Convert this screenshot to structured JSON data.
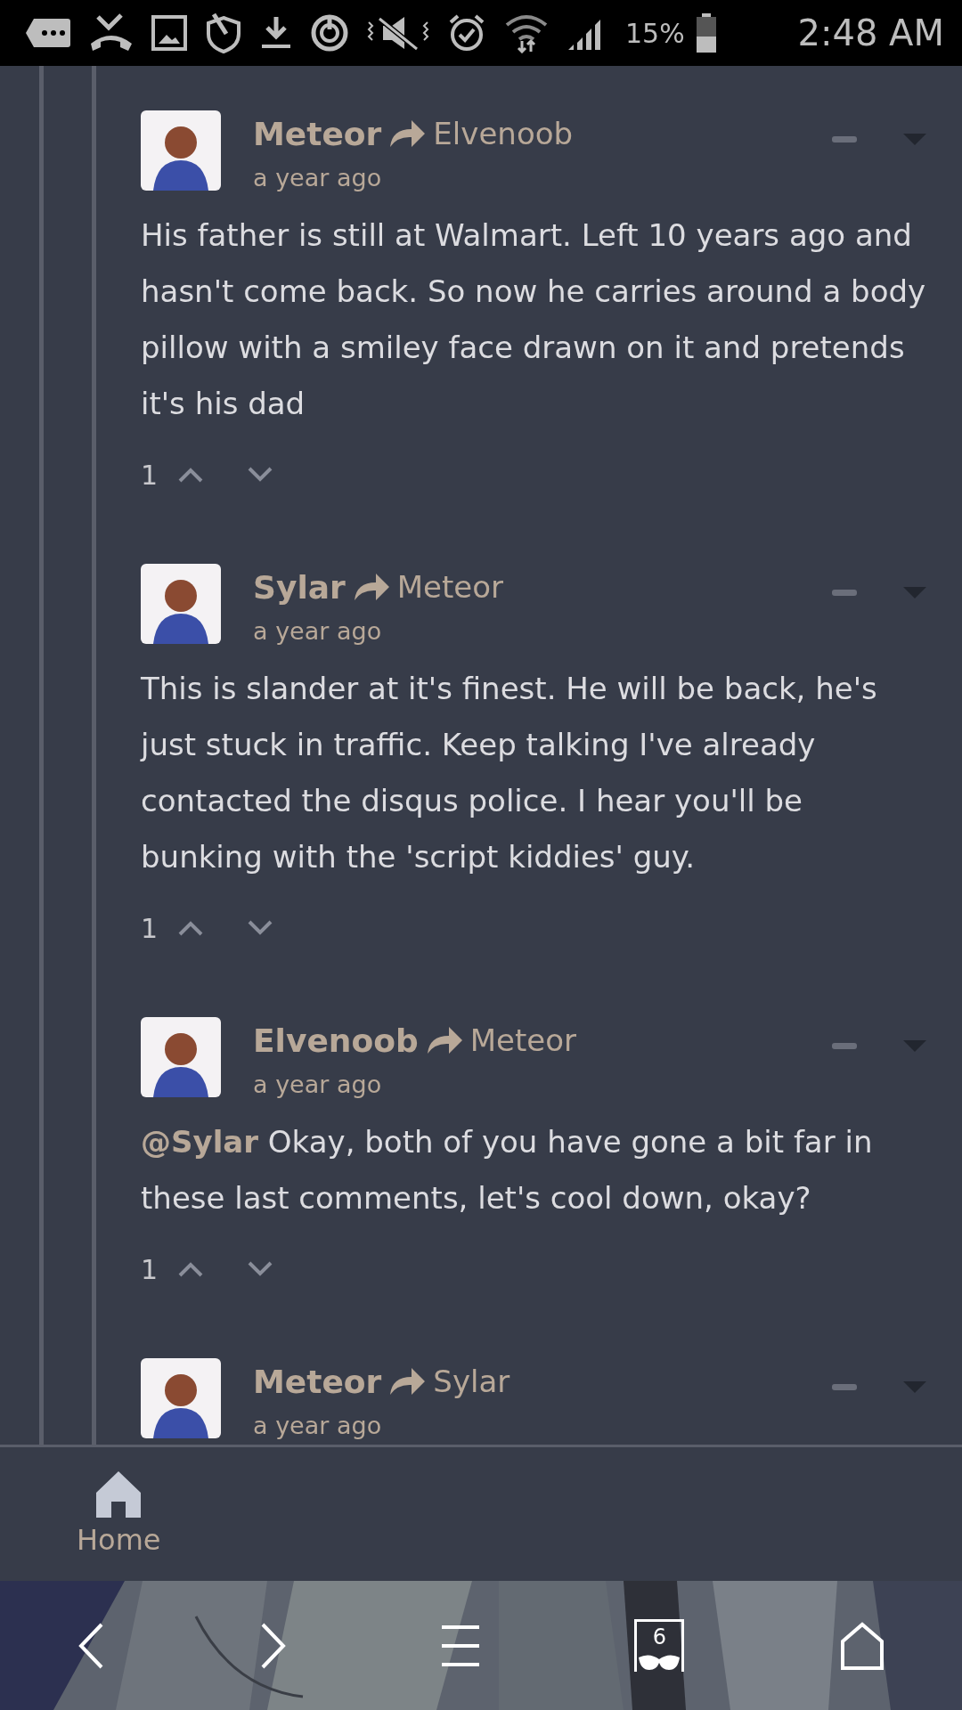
{
  "status_bar": {
    "battery": "15%",
    "time": "2:48 AM"
  },
  "comments": [
    {
      "author": "Meteor",
      "reply_to": "Elvenoob",
      "time": "a year ago",
      "body": "His father is still at Walmart. Left 10 years ago and hasn't come back. So now he carries around a body pillow with a smiley face drawn on it and pretends it's his dad",
      "votes": "1"
    },
    {
      "author": "Sylar",
      "reply_to": "Meteor",
      "time": "a year ago",
      "body": "This is slander at it's finest. He will be back, he's just stuck in traffic. Keep talking I've already contacted the disqus police. I hear you'll be bunking with the 'script kiddies' guy.",
      "votes": "1"
    },
    {
      "author": "Elvenoob",
      "reply_to": "Meteor",
      "time": "a year ago",
      "body": "**@Sylar** Okay, both of you have gone a bit far in these last comments, let's cool down, okay?",
      "votes": "1"
    },
    {
      "author": "Meteor",
      "reply_to": "Sylar",
      "time": "a year ago"
    }
  ],
  "bottom_tab": {
    "label": "Home"
  },
  "browser_bar": {
    "tab_count": "6"
  }
}
